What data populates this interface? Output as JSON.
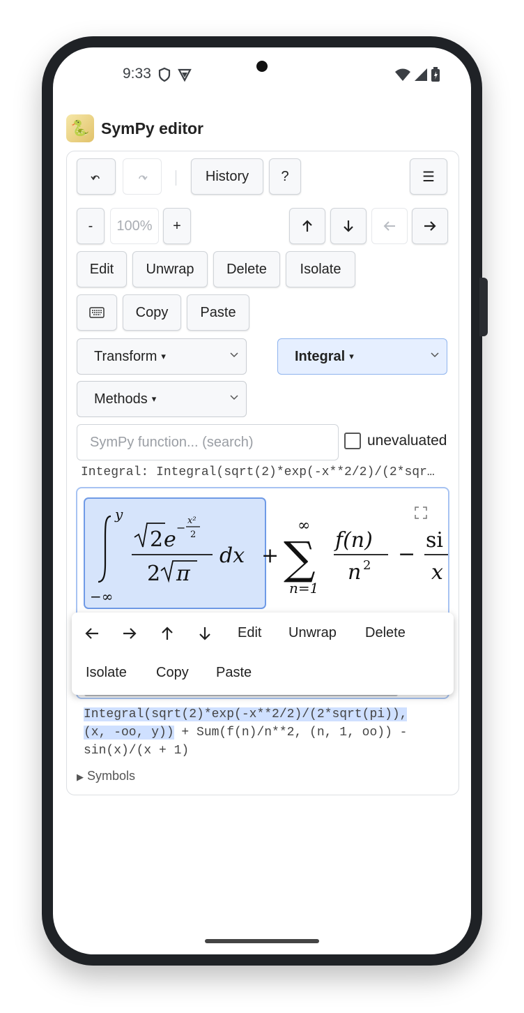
{
  "status": {
    "time": "9:33"
  },
  "app": {
    "title": "SymPy editor"
  },
  "toolbar": {
    "history": "History",
    "help": "?",
    "menu": "☰",
    "zoom_out": "-",
    "zoom": "100%",
    "zoom_in": "+",
    "edit": "Edit",
    "unwrap": "Unwrap",
    "delete": "Delete",
    "isolate": "Isolate",
    "copy": "Copy",
    "paste": "Paste"
  },
  "selects": {
    "transform": "Transform",
    "integral": "Integral",
    "methods": "Methods"
  },
  "search": {
    "placeholder": "SymPy function... (search)"
  },
  "unevaluated_label": "unevaluated",
  "preview": "Integral: Integral(sqrt(2)*exp(-x**2/2)/(2*sqr…",
  "math": {
    "upper_limit": "y",
    "lower_limit": "−∞",
    "dx": "dx",
    "plus": "+",
    "sum_top": "∞",
    "sum_bottom": "n=1",
    "sum_num": "f(n)",
    "sum_den": "n",
    "minus": "−",
    "sin_partial": "si",
    "x_partial": "x"
  },
  "context_menu": {
    "edit": "Edit",
    "unwrap": "Unwrap",
    "delete": "Delete",
    "isolate": "Isolate",
    "copy": "Copy",
    "paste": "Paste"
  },
  "code": {
    "selected_part1": "Integral(sqrt(2)*exp(-x**2/2)/(2*sqrt(pi)),",
    "selected_part2": "(x, -oo, y))",
    "rest_line2": " + Sum(f(n)/n**2, (n, 1, oo)) -",
    "line3": "sin(x)/(x + 1)"
  },
  "symbols_label": "Symbols"
}
